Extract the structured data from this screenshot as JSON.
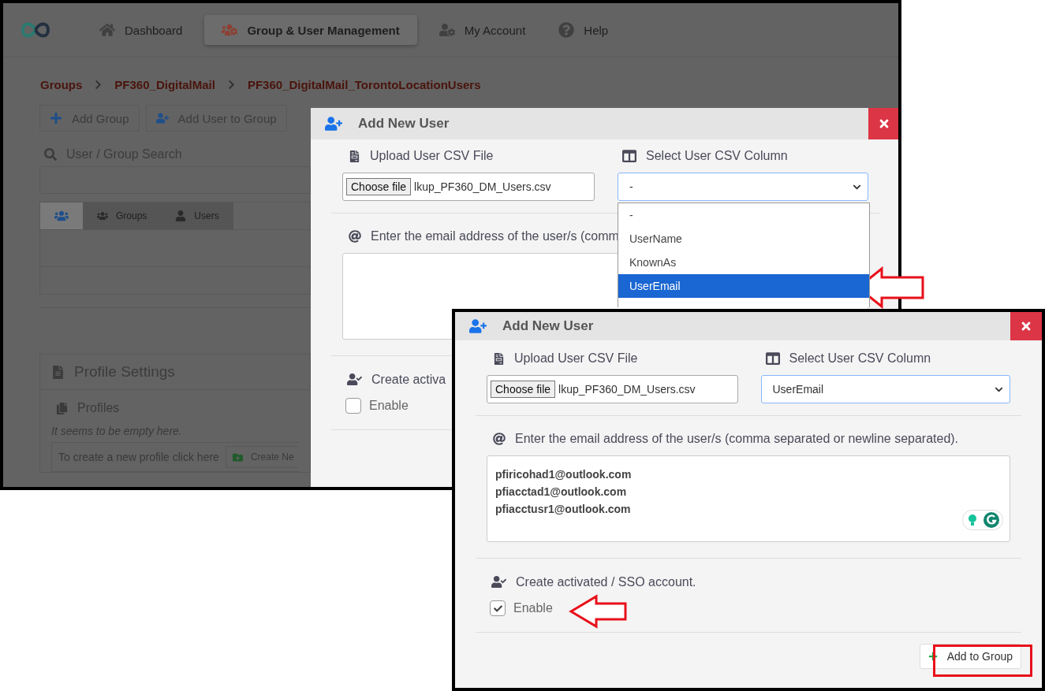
{
  "background_screenshot": {
    "nav": [
      {
        "label": "Dashboard",
        "kind": "home",
        "selected": false
      },
      {
        "label": "Group & User Management",
        "kind": "users",
        "selected": true
      },
      {
        "label": "My Account",
        "kind": "account",
        "selected": false
      },
      {
        "label": "Help",
        "kind": "help",
        "selected": false
      }
    ],
    "breadcrumbs": [
      "Groups",
      "PF360_DigitalMail",
      "PF360_DigitalMail_TorontoLocationUsers"
    ],
    "toolbar_buttons": [
      {
        "label": "Add Group",
        "kind": "add"
      },
      {
        "label": "Add User to Group",
        "kind": "add-user"
      }
    ],
    "search_label": "User / Group Search",
    "tabs": [
      {
        "kind": "all",
        "selected": true
      },
      {
        "kind": "groups",
        "label": "Groups",
        "selected": false
      },
      {
        "kind": "users",
        "label": "Users",
        "selected": false
      }
    ],
    "profile_settings": {
      "title": "Profile Settings",
      "subtitle": "Profiles",
      "empty_note": "It seems to be empty here.",
      "create_hint": "To create a new profile click here",
      "create_button": "Create Ne"
    },
    "dialog": {
      "title": "Add New User",
      "upload_label": "Upload User CSV File",
      "file_button": "Choose file",
      "file_name": "lkup_PF360_DM_Users.csv",
      "column_label": "Select User CSV Column",
      "column_value": "-",
      "column_options": [
        {
          "label": "-",
          "selected": false
        },
        {
          "label": "UserName",
          "selected": false
        },
        {
          "label": "KnownAs",
          "selected": false
        },
        {
          "label": "UserEmail",
          "selected": true
        }
      ],
      "email_label": "Enter the email address of the user/s (comm",
      "sso_label": "Create activa",
      "enable": {
        "label": "Enable",
        "checked": false
      }
    }
  },
  "front_screenshot": {
    "dialog": {
      "title": "Add New User",
      "upload_label": "Upload User CSV File",
      "file_button": "Choose file",
      "file_name": "lkup_PF360_DM_Users.csv",
      "column_label": "Select User CSV Column",
      "column_value": "UserEmail",
      "email_label": "Enter the email address of the user/s (comma separated or newline separated).",
      "emails": [
        "pfiricohad1@outlook.com",
        "pfiacctad1@outlook.com",
        "pfiacctusr1@outlook.com"
      ],
      "sso_label": "Create activated / SSO account.",
      "enable": {
        "label": "Enable",
        "checked": true
      },
      "submit_button": "Add to Group"
    }
  }
}
